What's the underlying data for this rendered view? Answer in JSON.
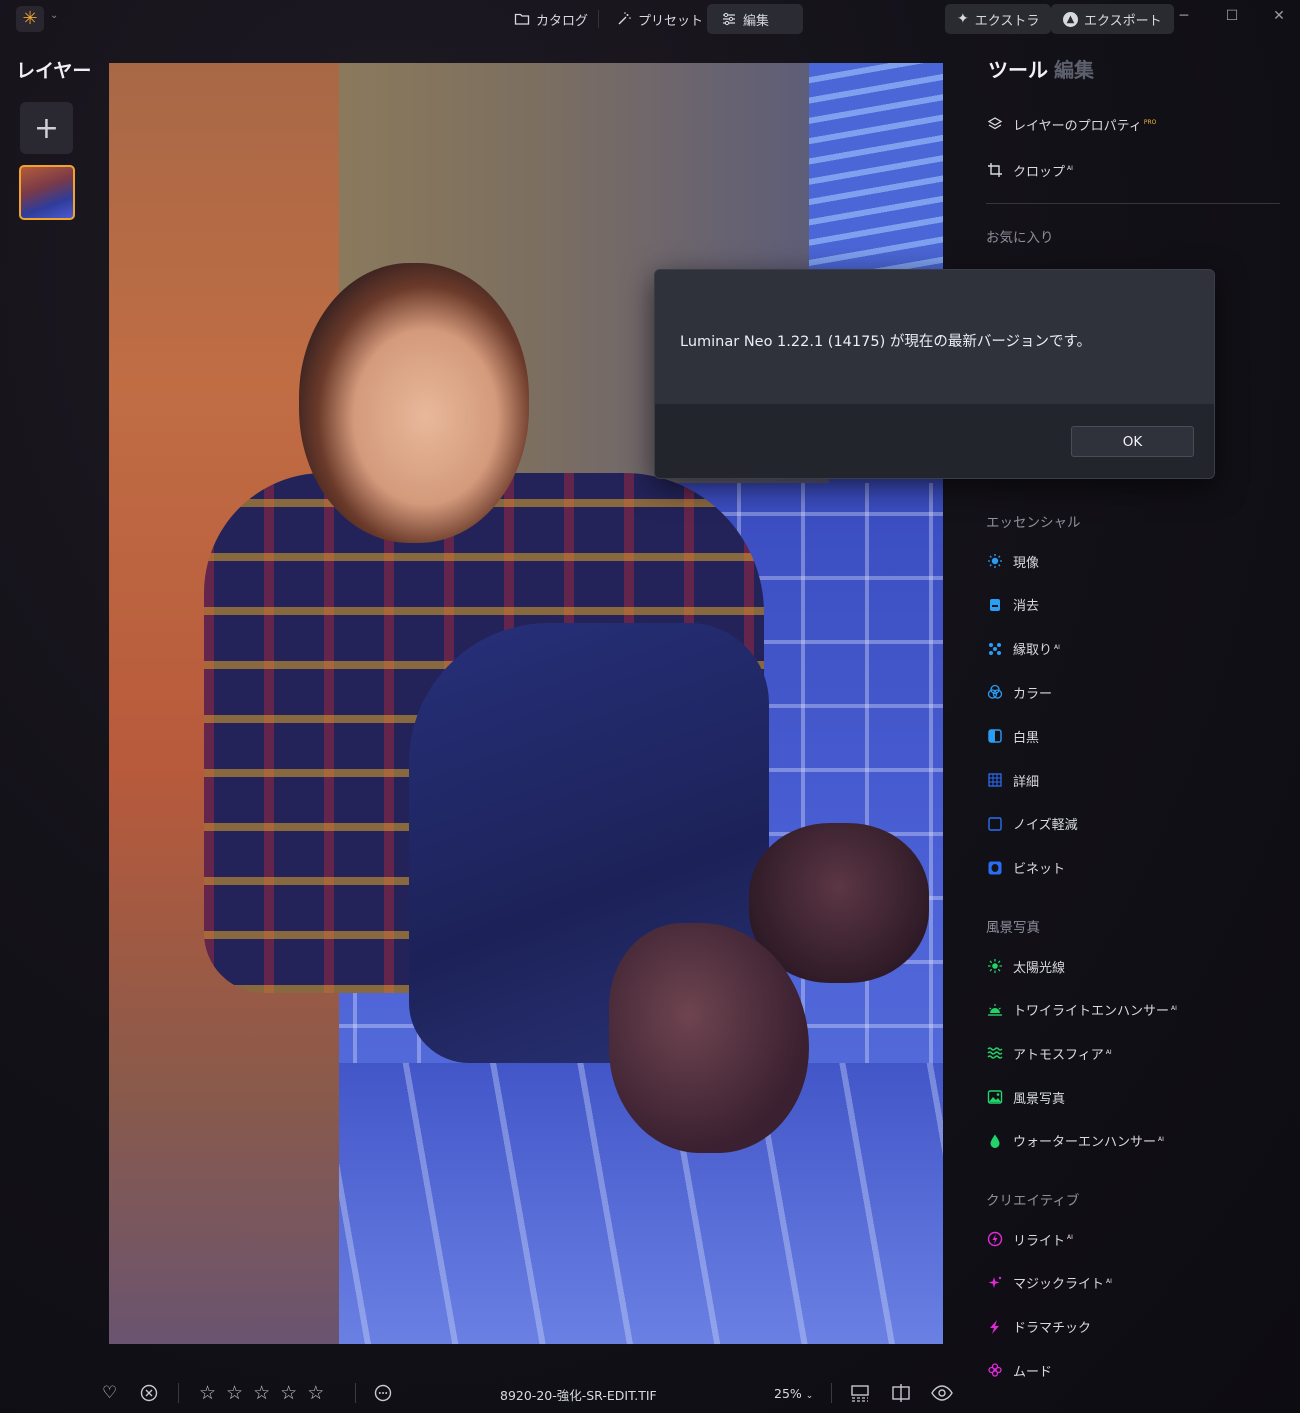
{
  "topbar": {
    "nav": [
      {
        "label": "カタログ",
        "icon": "folder-icon"
      },
      {
        "label": "プリセット",
        "icon": "magic-wand-icon"
      },
      {
        "label": "編集",
        "icon": "sliders-icon"
      }
    ],
    "extra_label": "エクストラ",
    "export_label": "エクスポート",
    "accent_color": "#f0a42b"
  },
  "layers": {
    "title": "レイヤー",
    "add_symbol": "+"
  },
  "panel": {
    "tab_tools": "ツール",
    "tab_edit": "編集",
    "top_tools": [
      {
        "label": "レイヤーのプロパティ",
        "badge": "PRO",
        "icon": "layers-icon"
      },
      {
        "label": "クロップ",
        "badge": "AI",
        "icon": "crop-icon"
      }
    ],
    "favorites_title": "お気に入り",
    "essentials_title": "エッセンシャル",
    "essentials": [
      {
        "label": "現像",
        "badge": "",
        "icon": "sun-icon",
        "color": "#2a9df4"
      },
      {
        "label": "消去",
        "badge": "",
        "icon": "eraser-icon",
        "color": "#2a9df4"
      },
      {
        "label": "縁取り",
        "badge": "AI",
        "icon": "dots-icon",
        "color": "#2a9df4"
      },
      {
        "label": "カラー",
        "badge": "",
        "icon": "color-circles-icon",
        "color": "#2a9df4"
      },
      {
        "label": "白黒",
        "badge": "",
        "icon": "half-square-icon",
        "color": "#2a9df4"
      },
      {
        "label": "詳細",
        "badge": "",
        "icon": "grid-icon",
        "color": "#2a6df4"
      },
      {
        "label": "ノイズ軽減",
        "badge": "",
        "icon": "noise-square-icon",
        "color": "#2a6df4"
      },
      {
        "label": "ビネット",
        "badge": "",
        "icon": "vignette-icon",
        "color": "#2a6df4"
      }
    ],
    "landscape_title": "風景写真",
    "landscape": [
      {
        "label": "太陽光線",
        "badge": "",
        "icon": "sunrays-icon",
        "color": "#22d36a"
      },
      {
        "label": "トワイライトエンハンサー",
        "badge": "AI",
        "icon": "twilight-icon",
        "color": "#22d36a"
      },
      {
        "label": "アトモスフィア",
        "badge": "AI",
        "icon": "waves-icon",
        "color": "#22d36a"
      },
      {
        "label": "風景写真",
        "badge": "",
        "icon": "landscape-image-icon",
        "color": "#22d36a"
      },
      {
        "label": "ウォーターエンハンサー",
        "badge": "AI",
        "icon": "water-drop-icon",
        "color": "#22d36a"
      }
    ],
    "creative_title": "クリエイティブ",
    "creative": [
      {
        "label": "リライト",
        "badge": "AI",
        "icon": "relight-icon",
        "color": "#e02ad8"
      },
      {
        "label": "マジックライト",
        "badge": "AI",
        "icon": "sparkle-icon",
        "color": "#e02ad8"
      },
      {
        "label": "ドラマチック",
        "badge": "",
        "icon": "lightning-icon",
        "color": "#e02ad8"
      },
      {
        "label": "ムード",
        "badge": "",
        "icon": "flower-icon",
        "color": "#e02ad8"
      }
    ]
  },
  "dialog": {
    "message": "Luminar Neo 1.22.1 (14175) が現在の最新バージョンです。",
    "ok_label": "OK"
  },
  "bottombar": {
    "filename": "8920-20-強化-SR-EDIT.TIF",
    "zoom": "25%",
    "star_rating": 0,
    "star_count": 5
  }
}
